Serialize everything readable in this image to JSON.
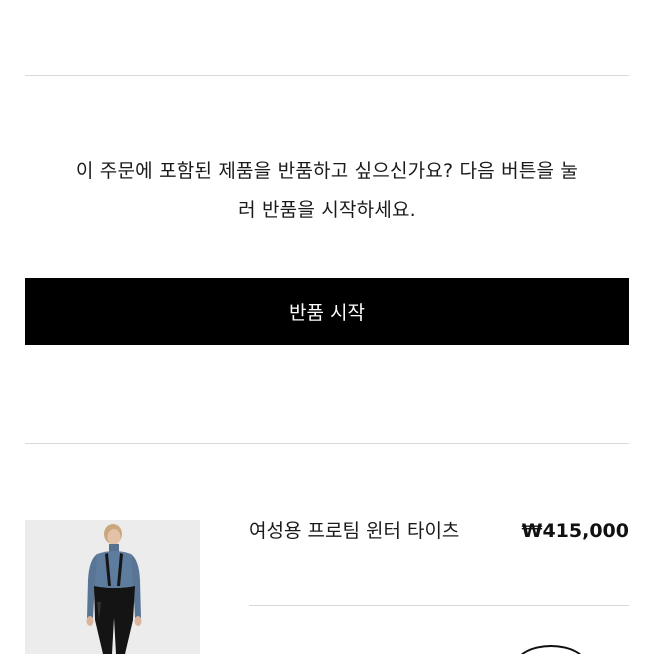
{
  "return_section": {
    "message_line1": "이 주문에 포함된 제품을 반품하고 싶으신가요? 다음 버튼을 눌",
    "message_line2": "러 반품을 시작하세요.",
    "button_label": "반품 시작"
  },
  "product": {
    "name": "여성용 프로팀 윈터 타이츠",
    "price": "₩415,000",
    "image_icon": "product-photo-icon"
  },
  "colors": {
    "button_bg": "#000000",
    "button_text": "#ffffff",
    "divider": "#d9d9d9",
    "image_bg": "#ececec"
  }
}
